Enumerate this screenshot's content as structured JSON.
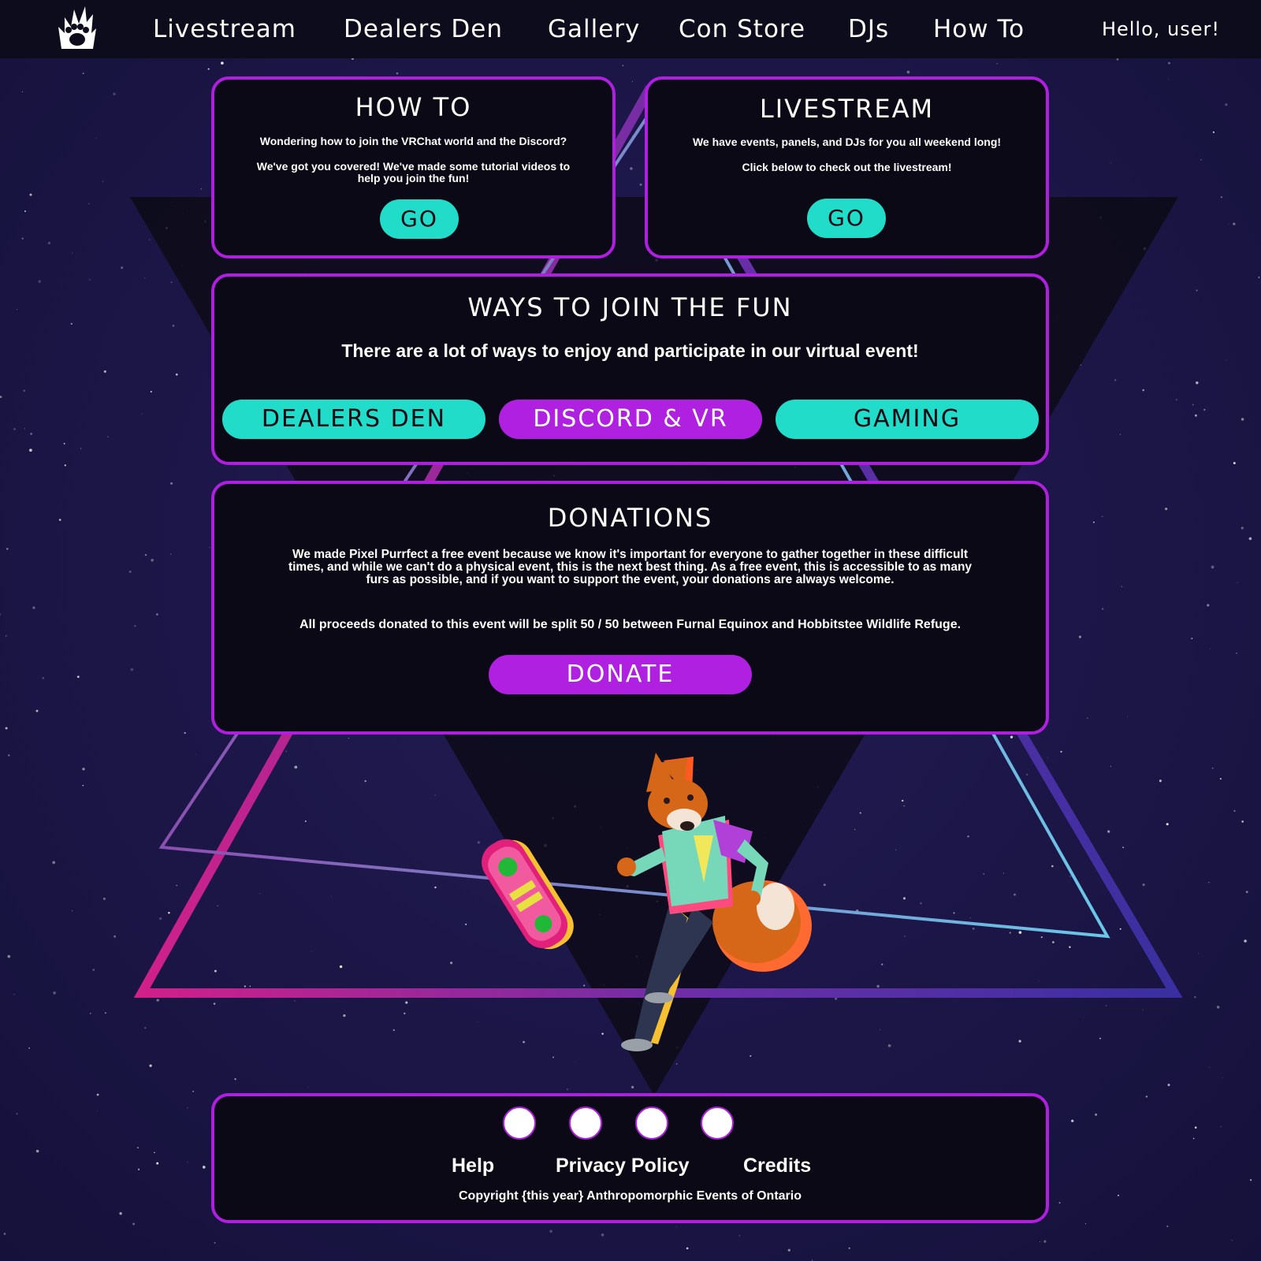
{
  "nav": {
    "logo_icon": "paw-flame-logo-icon",
    "items": [
      {
        "label": "Livestream"
      },
      {
        "label": "Dealers Den"
      },
      {
        "label": "Gallery"
      },
      {
        "label": "Con Store"
      },
      {
        "label": "DJs"
      },
      {
        "label": "How To"
      }
    ],
    "greeting": "Hello, user!"
  },
  "howto": {
    "title": "HOW TO",
    "line1": "Wondering how to join the VRChat world and the Discord?",
    "line2": "We've got you covered! We've made some tutorial videos to help you join the fun!",
    "button": "GO"
  },
  "livestream": {
    "title": "LIVESTREAM",
    "line1": "We have events, panels, and DJs for you all weekend long!",
    "line2": "Click below to check out the livestream!",
    "button": "GO"
  },
  "ways": {
    "title": "WAYS TO JOIN THE FUN",
    "subtitle": "There are a lot of ways to enjoy and participate in our virtual event!",
    "buttons": [
      {
        "label": "DEALERS DEN"
      },
      {
        "label": "DISCORD & VR"
      },
      {
        "label": "GAMING"
      }
    ]
  },
  "donations": {
    "title": "DONATIONS",
    "paragraph": "We made Pixel Purrfect a free event because we know it's important for everyone to gather together in these difficult times, and while we can't do a physical event, this is the next best thing. As a free event, this is accessible to as many furs as possible, and if you want to support the event, your donations are always welcome.",
    "split_note": "All proceeds donated to this event will be split 50 / 50 between Furnal Equinox and Hobbitstee Wildlife Refuge.",
    "button": "DONATE"
  },
  "footer": {
    "social_icons": [
      "social-icon-1",
      "social-icon-2",
      "social-icon-3",
      "social-icon-4"
    ],
    "links": [
      {
        "label": "Help"
      },
      {
        "label": "Privacy Policy"
      },
      {
        "label": "Credits"
      }
    ],
    "copyright": "Copyright {this year} Anthropomorphic Events of Ontario"
  },
  "colors": {
    "accent_purple": "#b01ee0",
    "accent_teal": "#20dcc8",
    "card_bg": "#0a0915",
    "topbar_bg": "#0d0c1c"
  }
}
